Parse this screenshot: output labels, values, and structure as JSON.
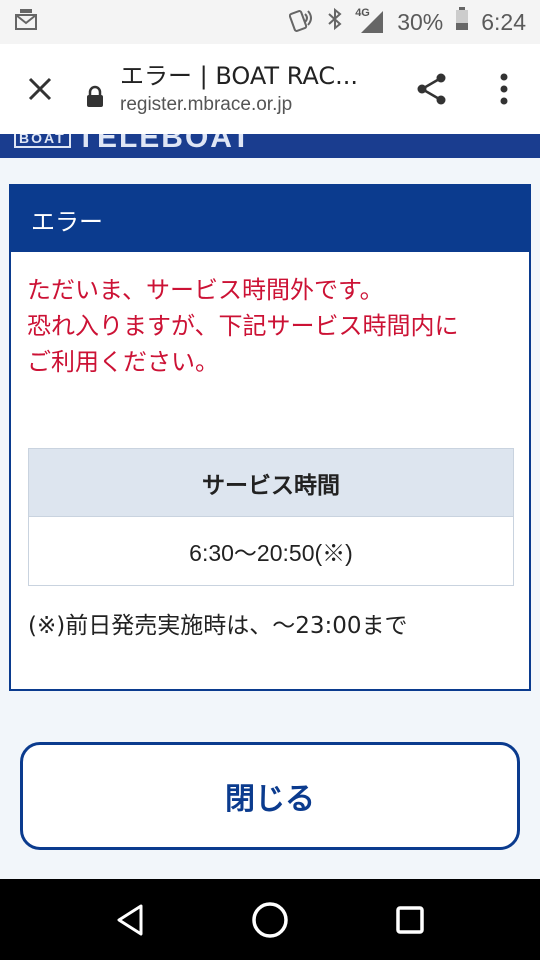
{
  "status_bar": {
    "battery_percent": "30%",
    "time": "6:24",
    "network_label": "4G"
  },
  "browser": {
    "page_title": "エラー | BOAT RAC...",
    "url": "register.mbrace.or.jp"
  },
  "site": {
    "logo_small": "BOAT",
    "logo_large": "TELEBOAT"
  },
  "error": {
    "heading": "エラー",
    "message_lines": [
      "ただいま、サービス時間外です。",
      "恐れ入りますが、下記サービス時間内に",
      "ご利用ください。"
    ]
  },
  "service_hours": {
    "header": "サービス時間",
    "value": "6:30〜20:50(※)",
    "note": "(※)前日発売実施時は、〜23:00まで"
  },
  "actions": {
    "close_label": "閉じる"
  },
  "colors": {
    "brand_blue": "#0b3b8e",
    "error_red": "#cc1235",
    "table_header_bg": "#dde5ef"
  }
}
